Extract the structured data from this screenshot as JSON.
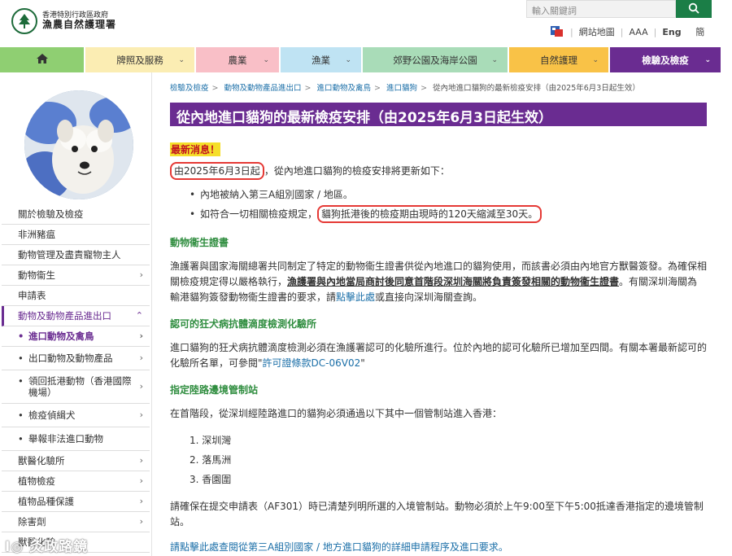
{
  "header": {
    "logo_line1": "香港特別行政區政府",
    "logo_line2": "漁農自然護理署",
    "search_placeholder": "輸入關鍵詞",
    "sitemap": "網站地圖",
    "text_size": "AAA",
    "lang_en": "Eng",
    "lang_sc": "簡"
  },
  "nav": {
    "home_icon": "home-icon",
    "items": [
      {
        "label": "牌照及服務",
        "color": "#fbedb3"
      },
      {
        "label": "農業",
        "color": "#f9bfc7"
      },
      {
        "label": "漁業",
        "color": "#bfe3f3"
      },
      {
        "label": "郊野公園及海岸公園",
        "color": "#a9dcb8"
      },
      {
        "label": "自然護理",
        "color": "#f9c247"
      },
      {
        "label": "檢驗及檢疫",
        "color": "#6a2c91"
      }
    ]
  },
  "sidebar": {
    "menu": [
      "關於檢驗及檢疫",
      "非洲豬瘟",
      "動物管理及盡責寵物主人",
      "動物衞生",
      "申請表",
      "動物及動物產品進出口",
      "進口動物及禽鳥",
      "出口動物及動物產品",
      "領回抵港動物（香港國際機場）",
      "檢疫偵緝犬",
      "舉報非法進口動物",
      "獸醫化驗所",
      "植物檢疫",
      "植物品種保護",
      "除害劑",
      "獸醫化驗"
    ]
  },
  "breadcrumb": [
    "檢驗及檢疫",
    "動物及動物產品進出口",
    "進口動物及禽鳥",
    "進口貓狗",
    "從內地進口貓狗的最新檢疫安排（由2025年6月3日起生效）"
  ],
  "page": {
    "title": "從內地進口貓狗的最新檢疫安排（由2025年6月3日起生效）",
    "latest_news": "最新消息！",
    "intro_date": "由2025年6月3日起",
    "intro_rest": "，從內地進口貓狗的檢疫安排將更新如下：",
    "bullet1": "內地被納入第三A組別國家 / 地區。",
    "bullet2_pre": "如符合一切相關檢疫規定，",
    "bullet2_box": "貓狗抵港後的檢疫期由現時的120天縮減至30天。",
    "sec1_title": "動物衞生證書",
    "sec1_text_a": "漁護署與國家海關總署共同制定了特定的動物衞生證書供從內地進口的貓狗使用，而該書必須由內地官方獸醫簽發。為確保相關檢疫規定得以嚴格執行，",
    "sec1_text_u": "漁護署與內地當局商討後同意首階段深圳海關將負責簽發相關的動物衞生證書",
    "sec1_text_b": "。有關深圳海關為輸港貓狗簽發動物衞生證書的要求，請",
    "sec1_link": "點擊此處",
    "sec1_text_c": "或直接向深圳海關查詢。",
    "sec2_title": "認可的狂犬病抗體滴度檢測化驗所",
    "sec2_text_a": "進口貓狗的狂犬病抗體滴度檢測必須在漁護署認可的化驗所進行。位於內地的認可化驗所已增加至四間。有關本署最新認可的化驗所名單，可參閱\"",
    "sec2_link": "許可證條款DC-06V02",
    "sec2_text_b": "\"",
    "sec3_title": "指定陸路邊境管制站",
    "sec3_text": "在首階段，從深圳經陸路進口的貓狗必須通過以下其中一個管制站進入香港：",
    "stations": [
      "1. 深圳灣",
      "2. 落馬洲",
      "3. 香園圍"
    ],
    "note": "請確保在提交申請表（AF301）時已清楚列明所選的入境管制站。動物必須於上午9:00至下午5:00抵達香港指定的邊境管制站。",
    "bottom_link": "請點擊此處查閱從第三A組別國家 / 地方進口貓狗的詳細申請程序及進口要求。"
  },
  "watermark": "I◎ 灸政路鏡"
}
